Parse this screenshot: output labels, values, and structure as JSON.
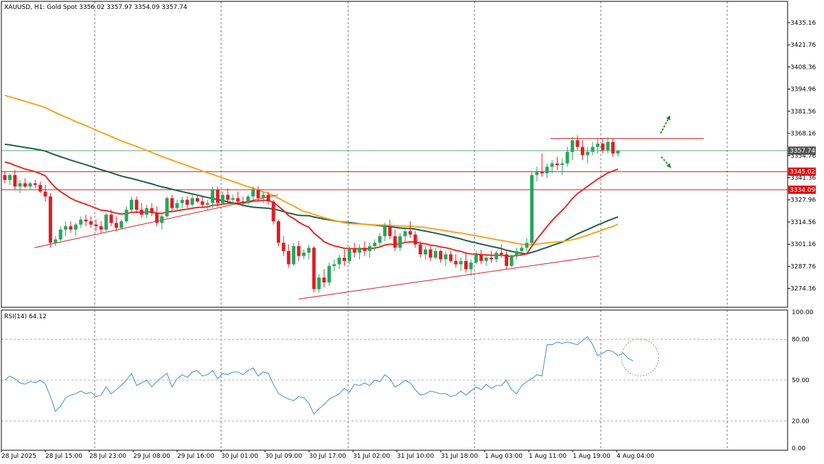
{
  "header": {
    "symbol": "XAUUSD",
    "timeframe": "H1",
    "instrument": "Gold Spot",
    "ohlc": "3356.02 3357.97 3354.09 3357.74"
  },
  "rsi_header": {
    "label": "RSI(14) 64.12"
  },
  "colors": {
    "bull": "#26a65b",
    "bear": "#e31b23",
    "ema_red": "#e8281f",
    "ma_orange": "#f4a51c",
    "ma_dark": "#1b5e45",
    "rsi": "#3a8dd6",
    "level": "#e01010",
    "price_line": "#2e8b57",
    "arrow": "#1f8a1f",
    "circle": "#55bb55",
    "trend": "#d11b1b"
  },
  "chart_data": [
    {
      "type": "candlestick",
      "title": "XAUUSD, H1: Gold Spot",
      "ylim": [
        3263,
        3448
      ],
      "y_ticks": [
        "3435.16",
        "3421.76",
        "3408.36",
        "3394.96",
        "3381.56",
        "3368.16",
        "3354.76",
        "3341.36",
        "3327.96",
        "3314.56",
        "3301.16",
        "3287.76",
        "3274.36"
      ],
      "x_ticks": [
        "28 Jul 2025",
        "28 Jul 15:00",
        "28 Jul 23:00",
        "29 Jul 08:00",
        "29 Jul 16:00",
        "30 Jul 01:00",
        "30 Jul 09:00",
        "30 Jul 17:00",
        "31 Jul 02:00",
        "31 Jul 10:00",
        "31 Jul 18:00",
        "1 Aug 03:00",
        "1 Aug 11:00",
        "1 Aug 19:00",
        "4 Aug 04:00"
      ],
      "current_price": "3357.74",
      "levels": [
        {
          "label": "3345.02",
          "value": 3345.02
        },
        {
          "label": "3334.09",
          "value": 3334.09
        }
      ],
      "candles": [
        [
          3343,
          3345,
          3338,
          3340
        ],
        [
          3340,
          3344,
          3337,
          3343
        ],
        [
          3343,
          3346,
          3334,
          3336
        ],
        [
          3336,
          3340,
          3332,
          3338
        ],
        [
          3338,
          3341,
          3335,
          3336
        ],
        [
          3336,
          3339,
          3334,
          3338
        ],
        [
          3338,
          3340,
          3335,
          3337
        ],
        [
          3337,
          3339,
          3332,
          3333
        ],
        [
          3333,
          3337,
          3327,
          3330
        ],
        [
          3330,
          3332,
          3299,
          3302
        ],
        [
          3302,
          3306,
          3300,
          3304
        ],
        [
          3304,
          3312,
          3303,
          3310
        ],
        [
          3310,
          3315,
          3306,
          3312
        ],
        [
          3312,
          3315,
          3308,
          3310
        ],
        [
          3310,
          3314,
          3306,
          3313
        ],
        [
          3313,
          3318,
          3311,
          3316
        ],
        [
          3316,
          3319,
          3312,
          3315
        ],
        [
          3315,
          3318,
          3311,
          3313
        ],
        [
          3313,
          3316,
          3309,
          3312
        ],
        [
          3312,
          3315,
          3308,
          3310
        ],
        [
          3310,
          3320,
          3309,
          3319
        ],
        [
          3319,
          3322,
          3312,
          3314
        ],
        [
          3314,
          3318,
          3309,
          3311
        ],
        [
          3311,
          3316,
          3310,
          3315
        ],
        [
          3315,
          3324,
          3314,
          3322
        ],
        [
          3322,
          3330,
          3320,
          3328
        ],
        [
          3328,
          3330,
          3320,
          3322
        ],
        [
          3322,
          3326,
          3317,
          3319
        ],
        [
          3319,
          3325,
          3317,
          3323
        ],
        [
          3323,
          3326,
          3318,
          3320
        ],
        [
          3320,
          3324,
          3312,
          3314
        ],
        [
          3314,
          3320,
          3310,
          3318
        ],
        [
          3318,
          3330,
          3317,
          3329
        ],
        [
          3329,
          3331,
          3321,
          3323
        ],
        [
          3323,
          3328,
          3321,
          3326
        ],
        [
          3326,
          3330,
          3323,
          3328
        ],
        [
          3328,
          3330,
          3323,
          3325
        ],
        [
          3325,
          3331,
          3324,
          3329
        ],
        [
          3329,
          3331,
          3326,
          3327
        ],
        [
          3327,
          3330,
          3323,
          3325
        ],
        [
          3325,
          3328,
          3322,
          3326
        ],
        [
          3326,
          3336,
          3323,
          3334
        ],
        [
          3334,
          3336,
          3324,
          3326
        ],
        [
          3326,
          3333,
          3325,
          3331
        ],
        [
          3331,
          3335,
          3326,
          3328
        ],
        [
          3328,
          3331,
          3325,
          3329
        ],
        [
          3329,
          3333,
          3325,
          3327
        ],
        [
          3327,
          3330,
          3324,
          3326
        ],
        [
          3326,
          3331,
          3325,
          3330
        ],
        [
          3330,
          3336,
          3328,
          3334
        ],
        [
          3334,
          3336,
          3327,
          3329
        ],
        [
          3329,
          3333,
          3326,
          3331
        ],
        [
          3331,
          3333,
          3325,
          3327
        ],
        [
          3327,
          3328,
          3313,
          3315
        ],
        [
          3315,
          3316,
          3300,
          3302
        ],
        [
          3302,
          3306,
          3294,
          3297
        ],
        [
          3297,
          3301,
          3287,
          3289
        ],
        [
          3289,
          3302,
          3288,
          3300
        ],
        [
          3300,
          3303,
          3291,
          3294
        ],
        [
          3294,
          3298,
          3292,
          3296
        ],
        [
          3296,
          3301,
          3292,
          3299
        ],
        [
          3299,
          3300,
          3272,
          3274
        ],
        [
          3274,
          3283,
          3272,
          3281
        ],
        [
          3281,
          3286,
          3275,
          3278
        ],
        [
          3278,
          3290,
          3276,
          3288
        ],
        [
          3288,
          3292,
          3285,
          3289
        ],
        [
          3289,
          3295,
          3286,
          3293
        ],
        [
          3293,
          3298,
          3288,
          3291
        ],
        [
          3291,
          3300,
          3289,
          3298
        ],
        [
          3298,
          3302,
          3293,
          3296
        ],
        [
          3296,
          3301,
          3292,
          3299
        ],
        [
          3299,
          3303,
          3294,
          3297
        ],
        [
          3297,
          3302,
          3293,
          3300
        ],
        [
          3300,
          3304,
          3297,
          3302
        ],
        [
          3302,
          3308,
          3299,
          3306
        ],
        [
          3306,
          3314,
          3303,
          3312
        ],
        [
          3312,
          3316,
          3304,
          3306
        ],
        [
          3306,
          3310,
          3297,
          3299
        ],
        [
          3299,
          3308,
          3297,
          3306
        ],
        [
          3306,
          3311,
          3302,
          3309
        ],
        [
          3309,
          3315,
          3305,
          3307
        ],
        [
          3307,
          3309,
          3299,
          3301
        ],
        [
          3301,
          3303,
          3293,
          3295
        ],
        [
          3295,
          3300,
          3292,
          3298
        ],
        [
          3298,
          3300,
          3291,
          3293
        ],
        [
          3293,
          3299,
          3292,
          3297
        ],
        [
          3297,
          3298,
          3290,
          3292
        ],
        [
          3292,
          3297,
          3288,
          3295
        ],
        [
          3295,
          3297,
          3290,
          3291
        ],
        [
          3291,
          3295,
          3287,
          3289
        ],
        [
          3289,
          3293,
          3285,
          3291
        ],
        [
          3291,
          3296,
          3284,
          3286
        ],
        [
          3286,
          3292,
          3282,
          3290
        ],
        [
          3290,
          3297,
          3289,
          3295
        ],
        [
          3295,
          3298,
          3289,
          3291
        ],
        [
          3291,
          3294,
          3288,
          3293
        ],
        [
          3293,
          3297,
          3290,
          3292
        ],
        [
          3292,
          3297,
          3290,
          3296
        ],
        [
          3296,
          3301,
          3293,
          3295
        ],
        [
          3295,
          3297,
          3286,
          3288
        ],
        [
          3288,
          3295,
          3287,
          3294
        ],
        [
          3294,
          3299,
          3292,
          3297
        ],
        [
          3297,
          3301,
          3294,
          3299
        ],
        [
          3299,
          3305,
          3297,
          3302
        ],
        [
          3302,
          3345,
          3301,
          3343
        ],
        [
          3343,
          3348,
          3339,
          3345
        ],
        [
          3345,
          3356,
          3342,
          3344
        ],
        [
          3344,
          3350,
          3341,
          3348
        ],
        [
          3348,
          3352,
          3344,
          3350
        ],
        [
          3350,
          3354,
          3346,
          3349
        ],
        [
          3349,
          3353,
          3343,
          3350
        ],
        [
          3350,
          3360,
          3348,
          3357
        ],
        [
          3357,
          3366,
          3352,
          3364
        ],
        [
          3364,
          3367,
          3358,
          3360
        ],
        [
          3360,
          3364,
          3352,
          3355
        ],
        [
          3355,
          3360,
          3350,
          3357
        ],
        [
          3357,
          3363,
          3355,
          3360
        ],
        [
          3360,
          3365,
          3356,
          3362
        ],
        [
          3362,
          3365,
          3356,
          3358
        ],
        [
          3358,
          3366,
          3356,
          3363
        ],
        [
          3363,
          3365,
          3354,
          3356
        ],
        [
          3356,
          3358,
          3354,
          3357.74
        ]
      ]
    },
    {
      "type": "line",
      "title": "RSI(14) 64.12",
      "ylim": [
        0,
        100
      ],
      "y_ticks": [
        "100.00",
        "80.00",
        "50.00",
        "20.00",
        "0.00"
      ],
      "levels": [
        80,
        50,
        20
      ],
      "series": [
        {
          "values": [
            50,
            53,
            51,
            48,
            47,
            49,
            48,
            50,
            47,
            38,
            27,
            31,
            37,
            39,
            40,
            42,
            40,
            41,
            38,
            39,
            45,
            40,
            43,
            46,
            50,
            55,
            46,
            48,
            50,
            45,
            49,
            52,
            55,
            45,
            51,
            54,
            52,
            56,
            57,
            53,
            54,
            57,
            51,
            55,
            54,
            56,
            56,
            54,
            57,
            59,
            53,
            56,
            55,
            47,
            40,
            38,
            36,
            35,
            38,
            37,
            33,
            25,
            29,
            32,
            36,
            38,
            40,
            44,
            41,
            47,
            46,
            48,
            46,
            50,
            49,
            54,
            51,
            45,
            47,
            50,
            48,
            43,
            39,
            40,
            42,
            41,
            40,
            40,
            38,
            39,
            42,
            39,
            42,
            45,
            43,
            47,
            44,
            46,
            46,
            50,
            43,
            40,
            46,
            49,
            51,
            54,
            53,
            76,
            76,
            78,
            77,
            78,
            77,
            76,
            79,
            82,
            76,
            68,
            70,
            72,
            71,
            68,
            70,
            66,
            64
          ]
        }
      ]
    }
  ]
}
